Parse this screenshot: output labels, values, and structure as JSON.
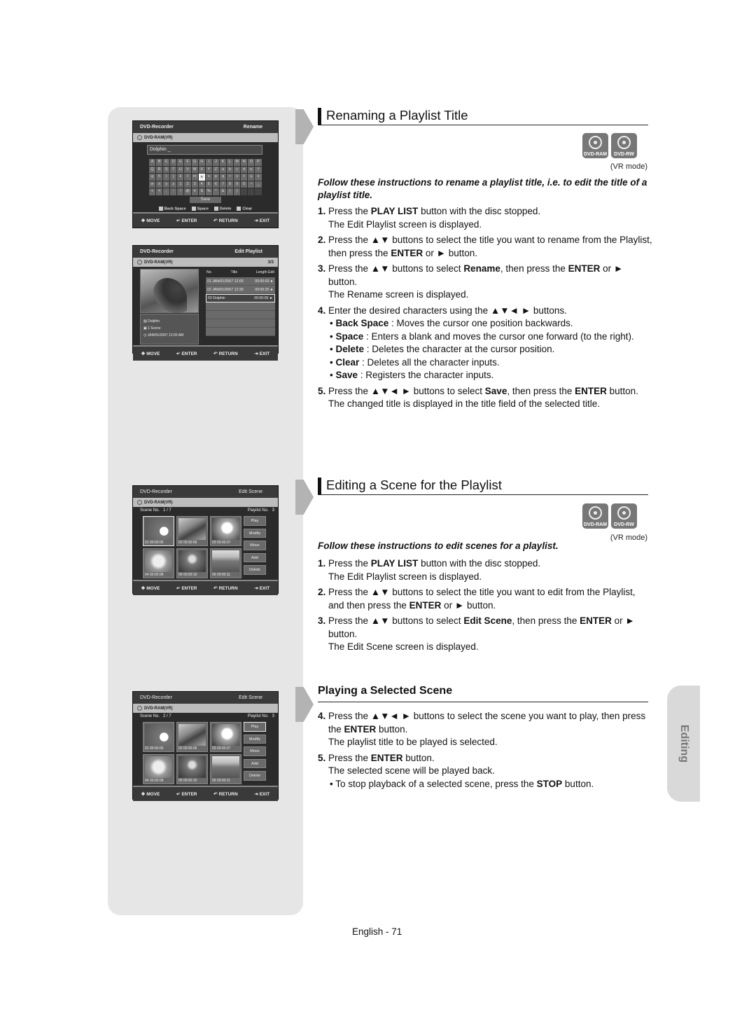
{
  "osd_common": {
    "brand": "DVD-Recorder",
    "disc": "DVD-RAM(VR)",
    "footer": {
      "move": "MOVE",
      "enter": "ENTER",
      "return": "RETURN",
      "exit": "EXIT"
    }
  },
  "rename_screen": {
    "mode": "Rename",
    "name_value": "Dolphin _",
    "keys": [
      [
        "A",
        "B",
        "C",
        "D",
        "E",
        "F",
        "G",
        "H",
        "I",
        "J",
        "K",
        "L",
        "M",
        "N",
        "O",
        "P"
      ],
      [
        "Q",
        "R",
        "S",
        "T",
        "U",
        "V",
        "W",
        "X",
        "Y",
        "Z",
        "a",
        "b",
        "c",
        "d",
        "e",
        "f"
      ],
      [
        "g",
        "h",
        "i",
        "j",
        "k",
        "l",
        "m",
        "n",
        "o",
        "p",
        "q",
        "r",
        "s",
        "t",
        "u",
        "v"
      ],
      [
        "w",
        "x",
        "y",
        "z",
        "1",
        "2",
        "3",
        "4",
        "5",
        "6",
        "7",
        "8",
        "9",
        "0",
        "~",
        "_"
      ],
      [
        "+",
        "=",
        ".",
        "-",
        "!",
        "@",
        "#",
        "$",
        "%",
        "^",
        "&",
        "(",
        ")",
        "",
        "",
        ""
      ]
    ],
    "selected_key": "n",
    "save_label": "Save",
    "legend": [
      "Back Space",
      "Space",
      "Delete",
      "Clear"
    ]
  },
  "playlist_screen": {
    "mode": "Edit Playlist",
    "counter": "3/3",
    "headers": [
      "No.",
      "Title",
      "Length",
      "Edit"
    ],
    "info": {
      "title": "Dolphin",
      "scenes": "1 Scene",
      "date": "JAN/01/2007 12:00 AM"
    },
    "rows": [
      {
        "text": "01 JAN/01/2007 12:00",
        "length": "00:00:03",
        "selected": false
      },
      {
        "text": "02 JAN/01/2007 12:30",
        "length": "00:00:25",
        "selected": false
      },
      {
        "text": "03 Dolphin",
        "length": "00:00:05",
        "selected": true
      }
    ]
  },
  "edit_scene_screens": [
    {
      "mode": "Edit Scene",
      "scene_no_label": "Scene No.",
      "scene_no": "1 / 7",
      "playlist_no_label": "Playlist No.",
      "playlist_no": "3",
      "selected_scene": 0,
      "selected_button": null
    },
    {
      "mode": "Edit Scene",
      "scene_no_label": "Scene No.",
      "scene_no": "2 / 7",
      "playlist_no_label": "Playlist No.",
      "playlist_no": "3",
      "selected_scene": null,
      "selected_button": 0
    }
  ],
  "scenes": [
    "01  00:00:05",
    "02  00:00:06",
    "03  00:00:07",
    "04  00:00:08",
    "05  00:00:10",
    "06  00:00:11"
  ],
  "scene_buttons": [
    "Play",
    "Modify",
    "Move",
    "Add",
    "Delete"
  ],
  "section1": {
    "title": "Renaming a Playlist Title",
    "discs": [
      "DVD-RAM",
      "DVD-RW"
    ],
    "vr_mode": "(VR mode)",
    "intro": "Follow these instructions to rename a playlist title, i.e. to edit the title of a playlist title."
  },
  "section2": {
    "title": "Editing a Scene for the Playlist",
    "discs": [
      "DVD-RAM",
      "DVD-RW"
    ],
    "vr_mode": "(VR mode)",
    "intro": "Follow these instructions to edit scenes for a playlist."
  },
  "section3": {
    "title": "Playing a Selected Scene"
  },
  "side_tab": "Editing",
  "page_number": "English - 71"
}
